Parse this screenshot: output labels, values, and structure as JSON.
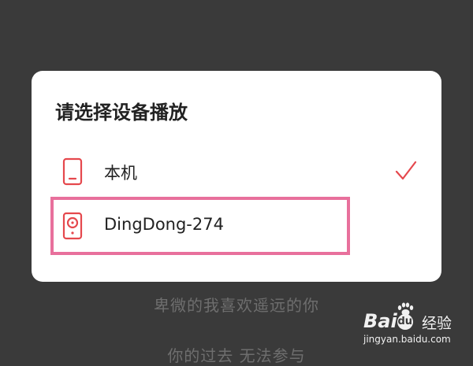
{
  "background_lyrics": {
    "line1": "卑微的我喜欢遥远的你",
    "line2": "你的过去 无法参与"
  },
  "dialog": {
    "title": "请选择设备播放",
    "options": [
      {
        "label": "本机",
        "icon": "phone-icon",
        "selected": true
      },
      {
        "label": "DingDong-274",
        "icon": "speaker-icon",
        "selected": false
      }
    ]
  },
  "watermark": {
    "brand": "Bai",
    "brand_du": "du",
    "product": "经验",
    "url": "jingyan.baidu.com"
  },
  "colors": {
    "accent": "#e5484d",
    "highlight": "#e8709c",
    "overlay": "#3a3a3a"
  }
}
